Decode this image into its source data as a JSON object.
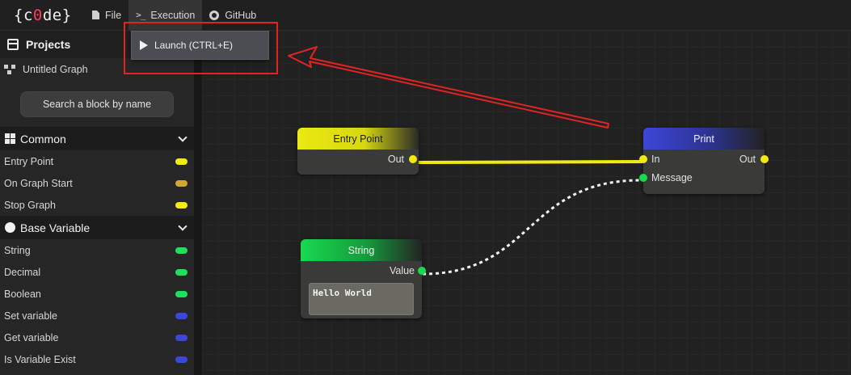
{
  "app": {
    "logo_open": "{",
    "logo_c": "c",
    "logo_zero": "0",
    "logo_de": "de",
    "logo_close": "}",
    "accent_color": "#ff3b5c"
  },
  "menu": {
    "file": "File",
    "execution": "Execution",
    "github": "GitHub"
  },
  "dropdown": {
    "launch": "Launch (CTRL+E)"
  },
  "sidebar": {
    "projects_title": "Projects",
    "project_item": "Untitled Graph",
    "search_button": "Search a block by name",
    "sections": [
      {
        "label": "Common",
        "icon": "grid-icon",
        "items": [
          {
            "label": "Entry Point",
            "color": "#f2ec12"
          },
          {
            "label": "On Graph Start",
            "color": "#d2a735"
          },
          {
            "label": "Stop Graph",
            "color": "#f2ec12"
          }
        ]
      },
      {
        "label": "Base Variable",
        "icon": "circle-icon",
        "items": [
          {
            "label": "String",
            "color": "#1fe05a"
          },
          {
            "label": "Decimal",
            "color": "#1fe05a"
          },
          {
            "label": "Boolean",
            "color": "#1fe05a"
          },
          {
            "label": "Set variable",
            "color": "#3c46d8"
          },
          {
            "label": "Get variable",
            "color": "#3c46d8"
          },
          {
            "label": "Is Variable Exist",
            "color": "#3c46d8"
          }
        ]
      }
    ]
  },
  "nodes": {
    "entry": {
      "title": "Entry Point",
      "out": "Out",
      "color": "#f0ea10"
    },
    "print": {
      "title": "Print",
      "in": "In",
      "out": "Out",
      "message": "Message",
      "color": "#3b47d8"
    },
    "string": {
      "title": "String",
      "value": "Value",
      "text": "Hello World",
      "color": "#19d94f"
    }
  }
}
